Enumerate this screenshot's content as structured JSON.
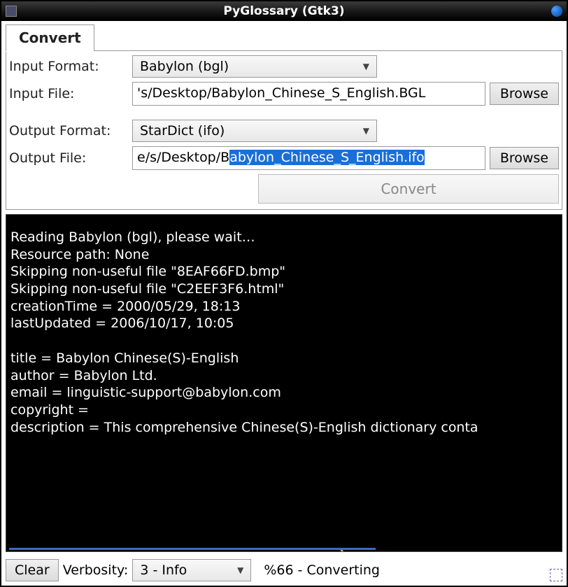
{
  "titlebar": {
    "text": "PyGlossary (Gtk3)"
  },
  "tabs": {
    "convert": "Convert"
  },
  "form": {
    "input_format_label": "Input Format:",
    "input_format_value": "Babylon (bgl)",
    "input_file_label": "Input File:",
    "input_file_value": "'s/Desktop/Babylon_Chinese_S_English.BGL",
    "output_format_label": "Output Format:",
    "output_format_value": "StarDict (ifo)",
    "output_file_label": "Output File:",
    "output_file_prefix": "e/s/Desktop/B",
    "output_file_selected": "abylon_Chinese_S_English.ifo",
    "browse": "Browse",
    "convert": "Convert"
  },
  "console": {
    "text": "Reading Babylon (bgl), please wait…\nResource path: None\nSkipping non-useful file \"8EAF66FD.bmp\"\nSkipping non-useful file \"C2EEF3F6.html\"\ncreationTime = 2000/05/29, 18:13\nlastUpdated = 2006/10/17, 10:05\n\ntitle = Babylon Chinese(S)-English\nauthor = Babylon Ltd.\nemail = linguistic-support@babylon.com\ncopyright =\ndescription = This comprehensive Chinese(S)-English dictionary conta",
    "progress_percent": 66
  },
  "statusbar": {
    "clear": "Clear",
    "verbosity_label": "Verbosity:",
    "verbosity_value": "3 - Info",
    "progress_text": "%66 - Converting"
  }
}
